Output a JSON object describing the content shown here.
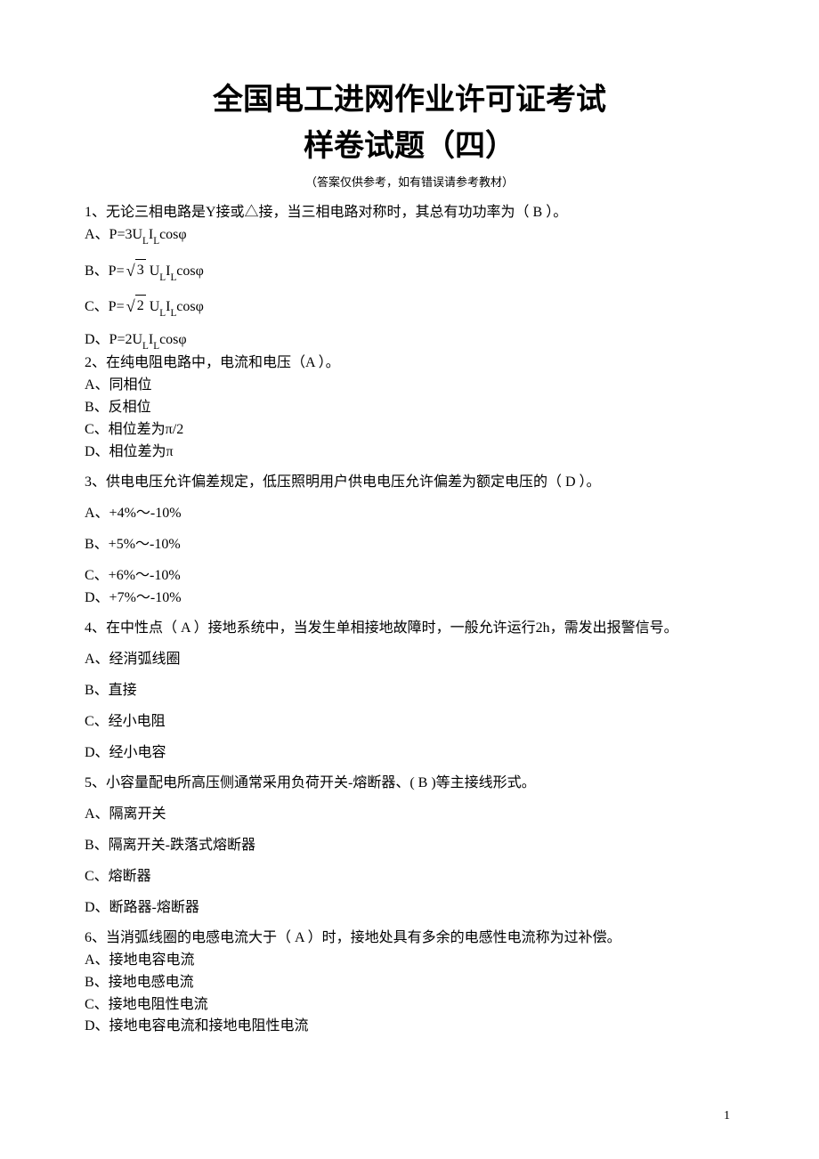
{
  "title_line1": "全国电工进网作业许可证考试",
  "title_line2": "样卷试题（四）",
  "note": "（答案仅供参考，如有错误请参考教材）",
  "q1": {
    "stem": "1、无论三相电路是Y接或△接，当三相电路对称时，其总有功功率为（  B  ）。",
    "A_pre": "A、P=3U",
    "B_pre": "B、P=",
    "B_sqrt": "3",
    "B_post": " U",
    "C_pre": "C、P=",
    "C_sqrt": "2",
    "C_post": " U",
    "D_pre": "D、P=2U",
    "tail": "cosφ",
    "subL": "L",
    "subI": "I"
  },
  "q2": {
    "stem": "2、在纯电阻电路中，电流和电压（A   ）。",
    "A": "A、同相位",
    "B": "B、反相位",
    "C": "C、相位差为π/2",
    "D": "D、相位差为π"
  },
  "q3": {
    "stem": "3、供电电压允许偏差规定，低压照明用户供电电压允许偏差为额定电压的（  D  ）。",
    "A": "A、+4%～-10%",
    "B": "B、+5%～-10%",
    "C": "C、+6%～-10%",
    "D": "D、+7%～-10%"
  },
  "q4": {
    "stem": "4、在中性点（  A  ）接地系统中，当发生单相接地故障时，一般允许运行2h，需发出报警信号。",
    "A": "A、经消弧线圈",
    "B": "B、直接",
    "C": "C、经小电阻",
    "D": "D、经小电容"
  },
  "q5": {
    "stem": "5、小容量配电所高压侧通常采用负荷开关-熔断器、( B )等主接线形式。",
    "A": "A、隔离开关",
    "B": "B、隔离开关-跌落式熔断器",
    "C": "C、熔断器",
    "D": "D、断路器-熔断器"
  },
  "q6": {
    "stem": "6、当消弧线圈的电感电流大于（  A  ）时，接地处具有多余的电感性电流称为过补偿。",
    "A": "A、接地电容电流",
    "B": "B、接地电感电流",
    "C": "C、接地电阻性电流",
    "D": "D、接地电容电流和接地电阻性电流"
  },
  "page_number": "1"
}
